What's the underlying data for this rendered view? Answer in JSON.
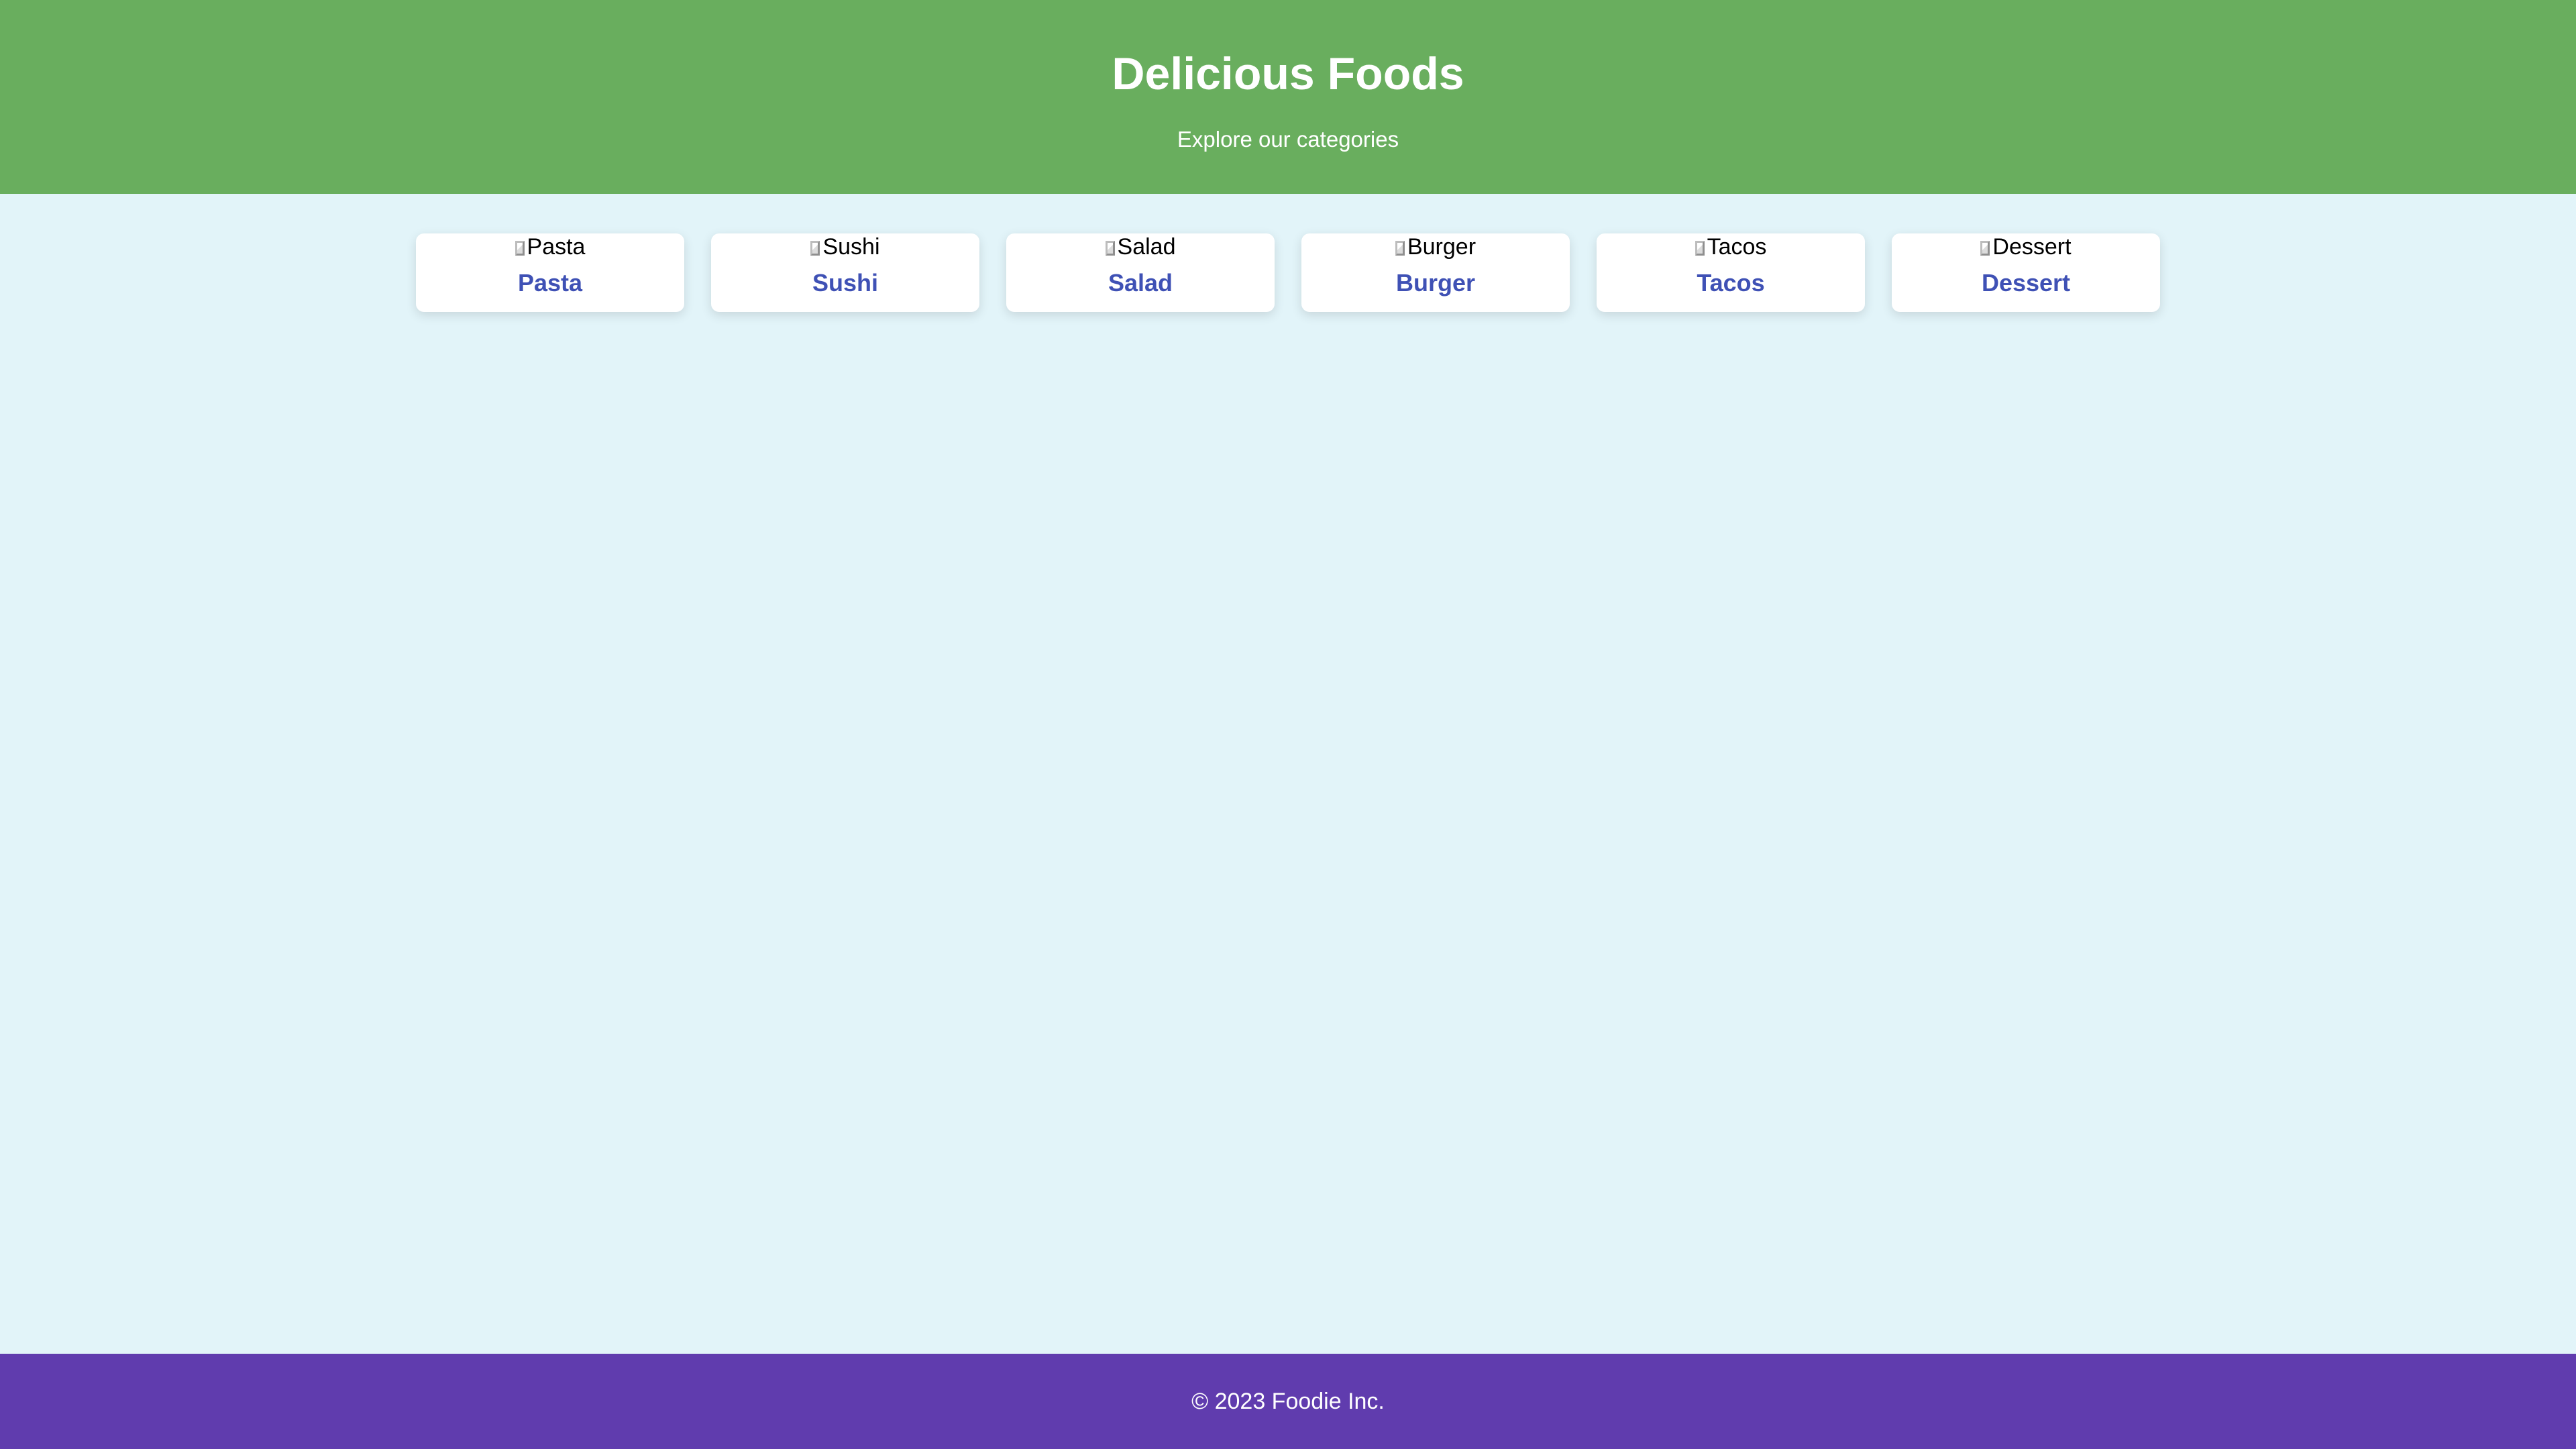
{
  "header": {
    "title": "Delicious Foods",
    "subtitle": "Explore our categories"
  },
  "categories": [
    {
      "image_alt": "Pasta",
      "label": "Pasta",
      "icon": "broken-image-icon"
    },
    {
      "image_alt": "Sushi",
      "label": "Sushi",
      "icon": "broken-image-icon"
    },
    {
      "image_alt": "Salad",
      "label": "Salad",
      "icon": "broken-image-icon"
    },
    {
      "image_alt": "Burger",
      "label": "Burger",
      "icon": "broken-image-icon"
    },
    {
      "image_alt": "Tacos",
      "label": "Tacos",
      "icon": "broken-image-icon"
    },
    {
      "image_alt": "Dessert",
      "label": "Dessert",
      "icon": "broken-image-icon"
    }
  ],
  "footer": {
    "text": "© 2023 Foodie Inc."
  },
  "colors": {
    "header_background": "#69ae5e",
    "page_background": "#e2f4f9",
    "card_background": "#ffffff",
    "label_color": "#3f51b5",
    "footer_background": "#603cae"
  }
}
